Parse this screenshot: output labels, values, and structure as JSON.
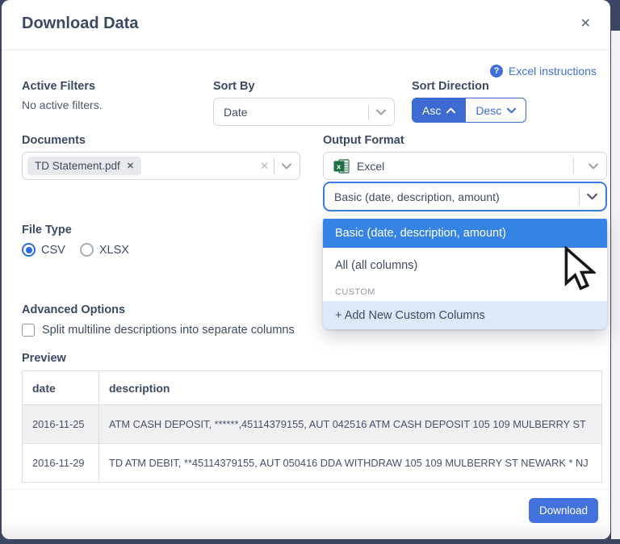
{
  "colors": {
    "accent_blue": "#3d6bd3",
    "menu_highlight_blue": "#3584e4",
    "focus_border_blue": "#3b7ce2",
    "download_button_blue": "#4472dd",
    "excel_green": "#1d7044",
    "add_option_bg": "#dde9f9"
  },
  "modal": {
    "title": "Download Data",
    "close_icon": "✕"
  },
  "help": {
    "label": "Excel instructions",
    "icon": "?"
  },
  "active_filters": {
    "label": "Active Filters",
    "empty_text": "No active filters."
  },
  "sort_by": {
    "label": "Sort By",
    "value": "Date"
  },
  "sort_direction": {
    "label": "Sort Direction",
    "asc_label": "Asc",
    "desc_label": "Desc",
    "selected": "Asc"
  },
  "documents": {
    "label": "Documents",
    "selected_tag": "TD Statement.pdf",
    "tag_remove_icon": "✕",
    "clear_icon": "✕"
  },
  "output_format": {
    "label": "Output Format",
    "value": "Excel",
    "icon": "excel"
  },
  "columns_select": {
    "value": "Basic (date, description, amount)"
  },
  "columns_menu": {
    "options": [
      "Basic (date, description, amount)",
      "All (all columns)"
    ],
    "selected_index": 0,
    "section_label": "CUSTOM",
    "add_option_label": "+ Add New Custom Columns"
  },
  "file_type": {
    "label": "File Type",
    "options": [
      "CSV",
      "XLSX"
    ],
    "selected": "CSV"
  },
  "advanced_options": {
    "label": "Advanced Options",
    "split_checkbox_label": "Split multiline descriptions into separate columns",
    "checked": false
  },
  "preview": {
    "label": "Preview",
    "columns": [
      "date",
      "description"
    ],
    "rows": [
      {
        "date": "2016-11-25",
        "description": "ATM CASH DEPOSIT, ******,45114379155, AUT 042516 ATM CASH DEPOSIT 105 109 MULBERRY ST"
      },
      {
        "date": "2016-11-29",
        "description": "TD ATM DEBIT, **45114379155, AUT 050416 DDA WITHDRAW 105 109 MULBERRY ST NEWARK * NJ"
      }
    ]
  },
  "footer": {
    "download_label": "Download"
  }
}
